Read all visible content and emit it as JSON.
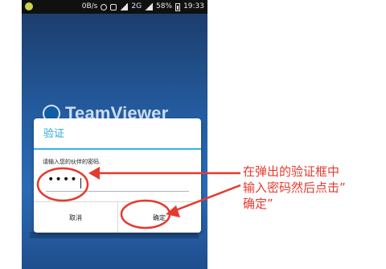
{
  "status_bar": {
    "net_speed": "0B/s",
    "network_type": "2G",
    "battery_percent": "58%",
    "time": "19:33",
    "icons": [
      "app-icon",
      "alarm-icon",
      "signal-icon",
      "battery-icon",
      "sync-icon"
    ]
  },
  "background_app": {
    "logo_text": "TeamViewer"
  },
  "dialog": {
    "title": "验证",
    "message": "请输入您的伙伴的密码.",
    "password_value": "••••",
    "cancel_label": "取消",
    "ok_label": "确定"
  },
  "annotation": {
    "lines": [
      "在弹出的验证框中",
      "输入密码然后点击”",
      "确定”"
    ]
  },
  "colors": {
    "accent": "#33b5e5",
    "annotation_red": "#e53a2e",
    "phone_bg": "#245ea3",
    "status_bar": "#101010"
  }
}
